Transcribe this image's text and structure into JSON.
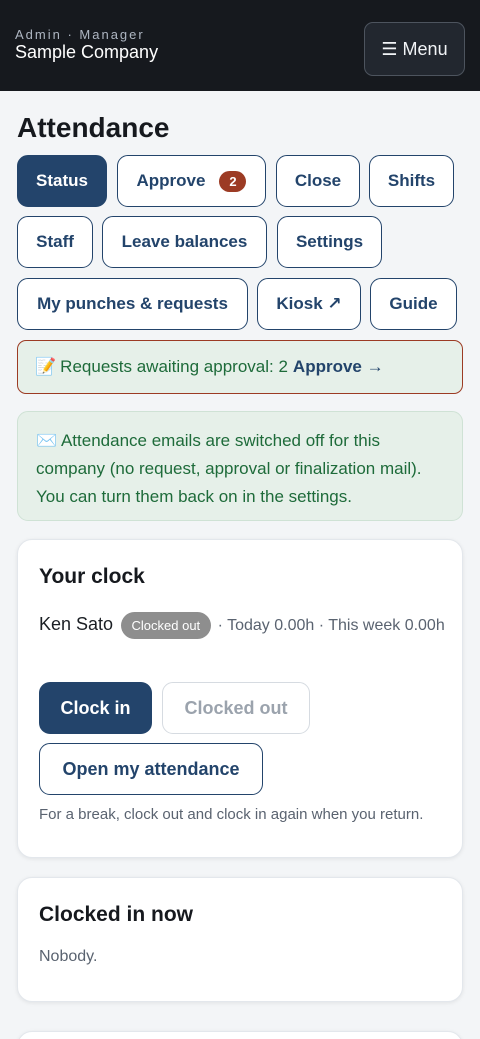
{
  "header": {
    "role": "Admin · Manager",
    "company": "Sample Company",
    "menu_icon": "☰",
    "menu_label": "Menu"
  },
  "page": {
    "title": "Attendance"
  },
  "tabs": {
    "status": "Status",
    "approve": "Approve",
    "approve_count": "2",
    "close": "Close",
    "shifts": "Shifts",
    "staff": "Staff",
    "leave": "Leave balances",
    "settings": "Settings",
    "punches": "My punches & requests",
    "kiosk": "Kiosk ↗",
    "guide": "Guide"
  },
  "alert": {
    "icon": "📝",
    "text": "Requests awaiting approval: 2",
    "link": "Approve →"
  },
  "notice": {
    "icon": "✉️",
    "text": "Attendance emails are switched off for this company (no request, approval or finalization mail). You can turn them back on in the settings."
  },
  "clock_card": {
    "title": "Your clock",
    "name": "Ken Sato",
    "status": "Clocked out",
    "summary": "· Today 0.00h · This week 0.00h",
    "clock_in": "Clock in",
    "clocked_out": "Clocked out",
    "open": "Open my attendance",
    "hint": "For a break, clock out and clock in again when you return."
  },
  "now_card": {
    "title": "Clocked in now",
    "empty": "Nobody."
  }
}
